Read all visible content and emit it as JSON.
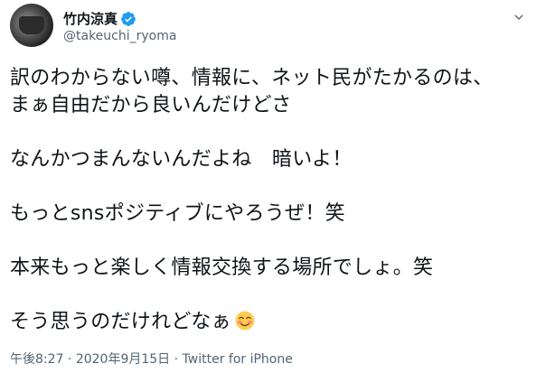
{
  "author": {
    "display_name": "竹内涼真",
    "handle": "@takeuchi_ryoma",
    "verified_color": "#1d9bf0"
  },
  "tweet": {
    "lines": [
      "訳のわからない噂、情報に、ネット民がたかるのは、",
      "まぁ自由だから良いんだけどさ",
      "",
      "なんかつまんないんだよね　暗いよ！",
      "",
      "もっとsnsポジティブにやろうぜ！笑",
      "",
      "本来もっと楽しく情報交換する場所でしょ。笑",
      "",
      "そう思うのだけれどなぁ"
    ],
    "emoji": "smiling-face-with-rosy-cheeks"
  },
  "meta": {
    "time": "午後8:27",
    "separator": " · ",
    "date": "2020年9月15日",
    "source": "Twitter for iPhone"
  },
  "icons": {
    "more": "chevron-down-icon",
    "verified": "verified-badge-icon"
  }
}
